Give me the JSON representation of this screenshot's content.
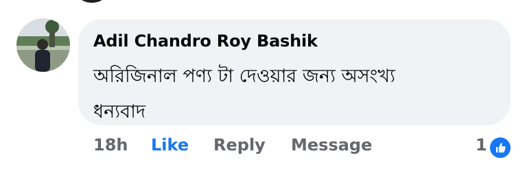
{
  "comment": {
    "author": "Adil Chandro Roy Bashik",
    "text": "অরিজিনাল পণ্য টা দেওয়ার জন্য অসংখ্য\nধন্যবাদ",
    "time": "18h",
    "like_label": "Like",
    "reply_label": "Reply",
    "message_label": "Message",
    "reaction_count": "1",
    "reaction_icon": "thumbs-up-icon"
  },
  "colors": {
    "bubble": "#f0f2f5",
    "like_active": "#1877f2",
    "secondary_text": "#65676b",
    "primary_text": "#050505"
  }
}
